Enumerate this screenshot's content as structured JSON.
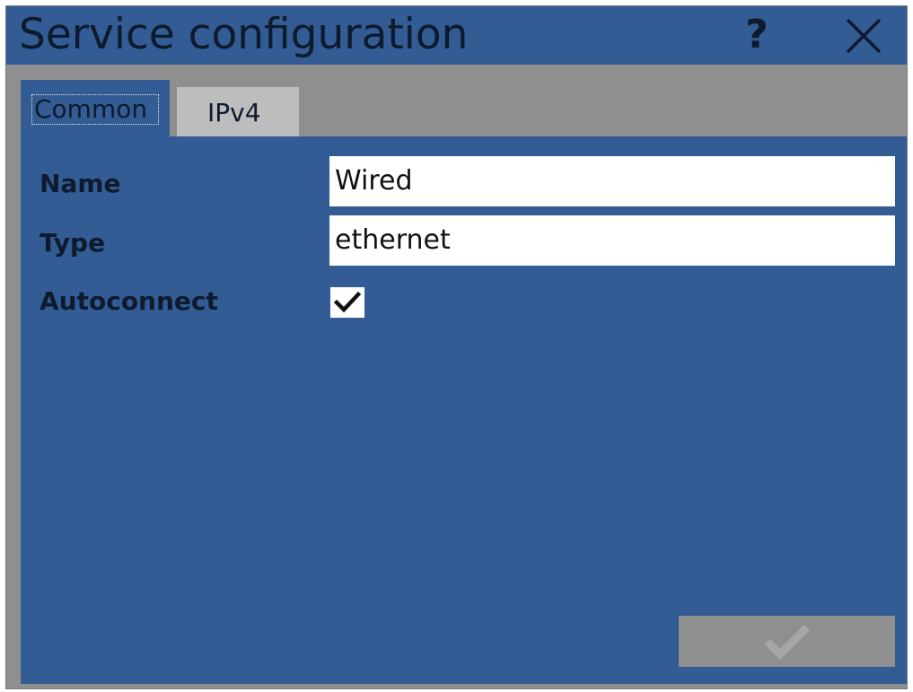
{
  "window": {
    "title": "Service configuration",
    "help_label": "?"
  },
  "tabs": [
    {
      "label": "Common",
      "selected": true
    },
    {
      "label": "IPv4",
      "selected": false
    }
  ],
  "form": {
    "name_label": "Name",
    "name_value": "Wired",
    "type_label": "Type",
    "type_value": "ethernet",
    "autoconnect_label": "Autoconnect",
    "autoconnect_checked": true
  },
  "colors": {
    "accent": "#325c93",
    "frame": "#8f8f8f",
    "inactive_tab": "#bdbdbd",
    "text": "#0e1a2d"
  },
  "icons": {
    "close": "close-icon",
    "checkbox": "checkmark-icon",
    "ok": "checkmark-icon"
  }
}
